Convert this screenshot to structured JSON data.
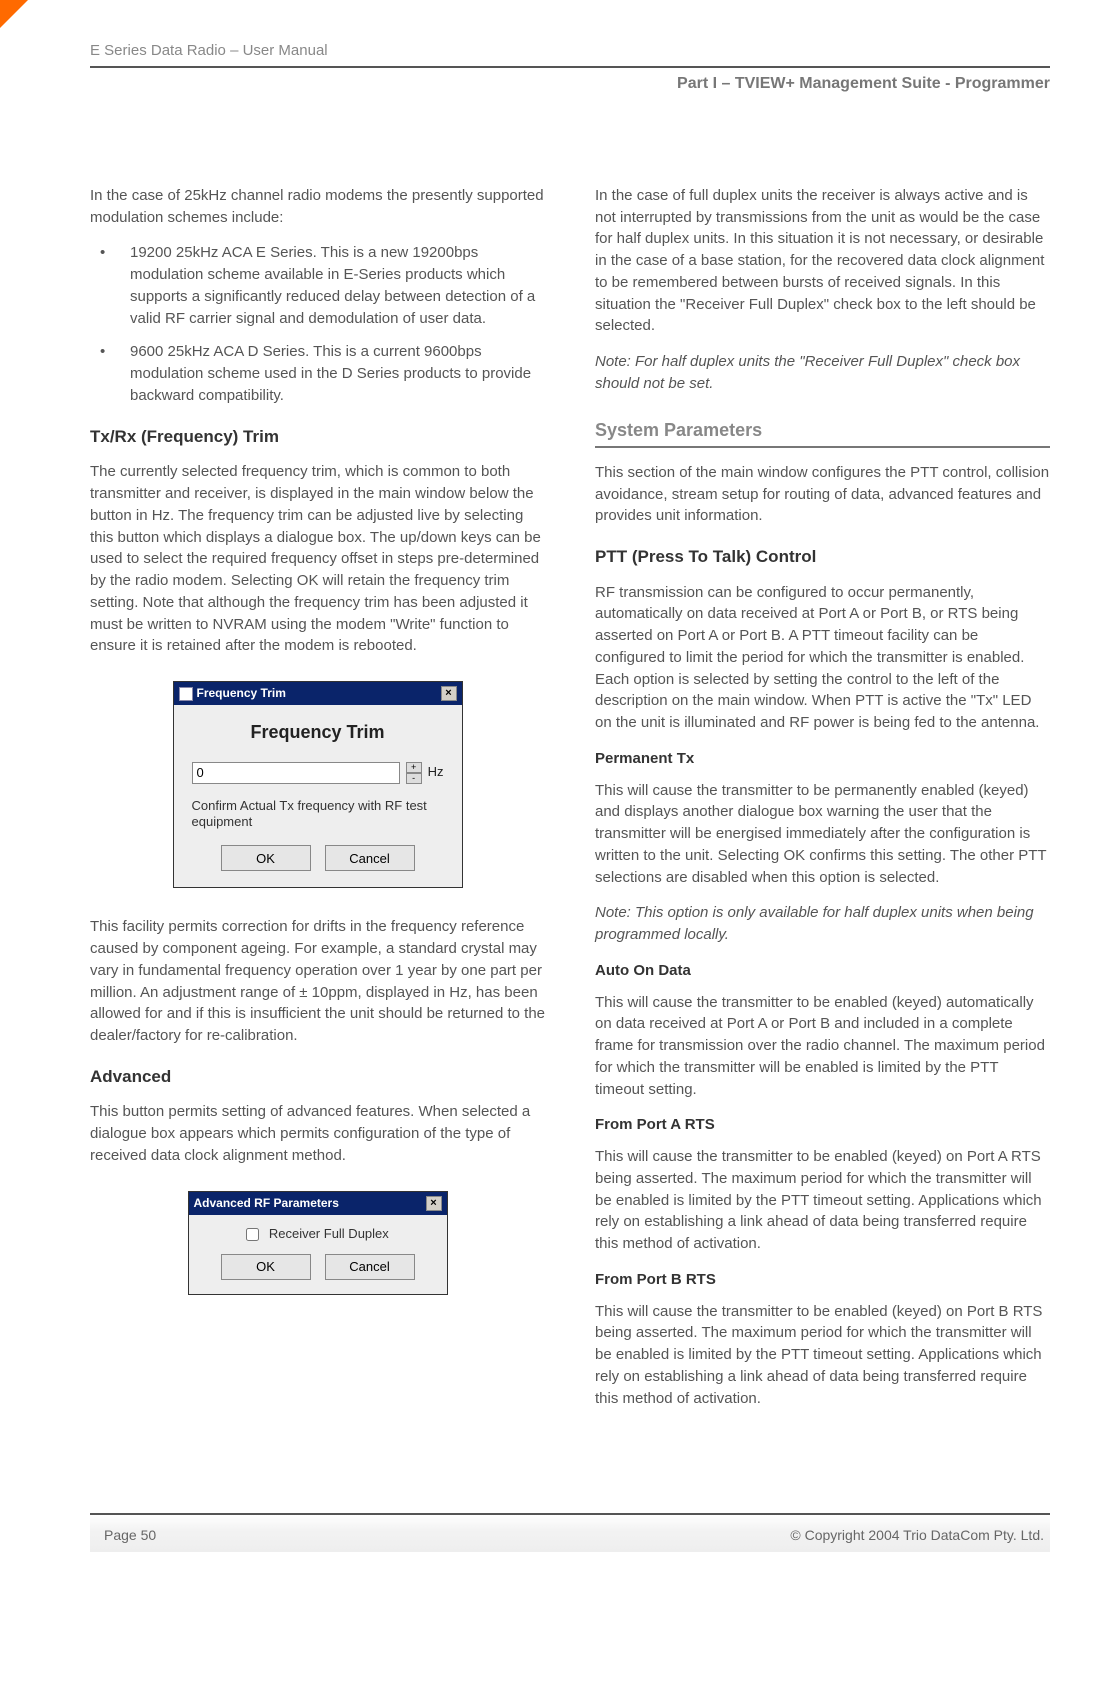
{
  "header": {
    "doc_title": "E Series Data Radio – User Manual",
    "part_line": "Part I – TVIEW+ Management Suite - Programmer"
  },
  "left": {
    "intro": "In the case of 25kHz channel radio modems the presently supported modulation schemes include:",
    "bullets": [
      "19200 25kHz ACA E Series. This is a new 19200bps modulation scheme available in E-Series products which supports a significantly reduced delay between detection of a valid RF carrier signal and demodulation of user data.",
      "9600 25kHz ACA D Series. This is a current 9600bps modulation scheme used in the D Series products to provide backward compatibility."
    ],
    "txrx_h": "Tx/Rx (Frequency) Trim",
    "txrx_p": "The currently selected frequency trim, which is common to both transmitter and receiver, is displayed in the main window below the button in Hz. The frequency trim can be adjusted live by selecting this button which displays a dialogue box. The up/down keys can be used to select the required frequency offset in steps pre-determined by the radio modem. Selecting OK will retain the frequency trim setting. Note that although the frequency trim has been adjusted it must be written to NVRAM using the modem \"Write\" function to ensure it is retained after the modem is rebooted.",
    "dlg_freq": {
      "title": "Frequency Trim",
      "heading": "Frequency Trim",
      "value": "0",
      "unit": "Hz",
      "hint": "Confirm Actual Tx frequency with RF test equipment",
      "ok": "OK",
      "cancel": "Cancel"
    },
    "drift_p": "This facility permits correction for drifts in the frequency reference caused by component ageing.  For example, a standard crystal may vary in fundamental frequency operation over 1 year by one part per million. An adjustment range of ± 10ppm, displayed in Hz, has been allowed for and if this is insufficient the unit should be returned to the dealer/factory for re-calibration.",
    "adv_h": "Advanced",
    "adv_p": "This button permits setting of advanced features. When selected a dialogue box appears which permits configuration of the type of received data clock alignment method.",
    "dlg_adv": {
      "title": "Advanced RF Parameters",
      "chk_label": "Receiver Full Duplex",
      "ok": "OK",
      "cancel": "Cancel"
    }
  },
  "right": {
    "fd_p": "In the case of full duplex units the receiver is always active and is not interrupted by transmissions from the unit as would be the case for half duplex units. In this situation it is not necessary, or desirable in the case of a base station, for the recovered data clock alignment to be remembered between bursts of received signals. In this situation the \"Receiver Full Duplex\" check box to the left should be selected.",
    "fd_note": "Note: For half duplex units the \"Receiver Full Duplex\" check box should not be set.",
    "sys_h": "System Parameters",
    "sys_p": "This section of the main window configures the PTT control, collision avoidance, stream setup for routing of data, advanced features and provides unit information.",
    "ptt_h": "PTT (Press To Talk) Control",
    "ptt_p": "RF transmission can be configured to occur permanently, automatically on data received at Port A or Port B, or RTS being asserted on Port A or Port B. A PTT timeout facility can be configured to limit the period for which the transmitter is enabled. Each option is selected by setting the control to the left of the description on the main window. When PTT is active the \"Tx\" LED on the unit is illuminated and RF power is being fed to the antenna.",
    "perm_h": "Permanent Tx",
    "perm_p": "This will cause the transmitter to be permanently enabled (keyed) and displays another dialogue box warning the user that the transmitter will be energised immediately after the configuration is written to the unit. Selecting OK confirms this setting. The other PTT selections are disabled when this option is selected.",
    "perm_note": "Note: This option is only available for half duplex units when being programmed locally.",
    "auto_h": "Auto On Data",
    "auto_p": "This will cause the transmitter to be enabled (keyed) automatically on data received at Port A or Port B and included in a complete frame for transmission over the radio channel. The maximum period for which the transmitter will be enabled is limited by the PTT timeout setting.",
    "pa_h": "From Port A RTS",
    "pa_p": "This will cause the transmitter to be enabled (keyed) on Port A RTS being asserted. The maximum period for which the transmitter will be enabled is limited by the PTT timeout setting. Applications which rely on establishing a link ahead of data being transferred require this method of activation.",
    "pb_h": "From Port B RTS",
    "pb_p": "This will cause the transmitter to be enabled (keyed) on Port B RTS being asserted. The maximum period for which the transmitter will be enabled is limited by the PTT timeout setting. Applications which rely on establishing a link ahead of data being transferred require this method of activation."
  },
  "footer": {
    "page": "Page 50",
    "copyright": "© Copyright 2004 Trio DataCom Pty. Ltd."
  }
}
